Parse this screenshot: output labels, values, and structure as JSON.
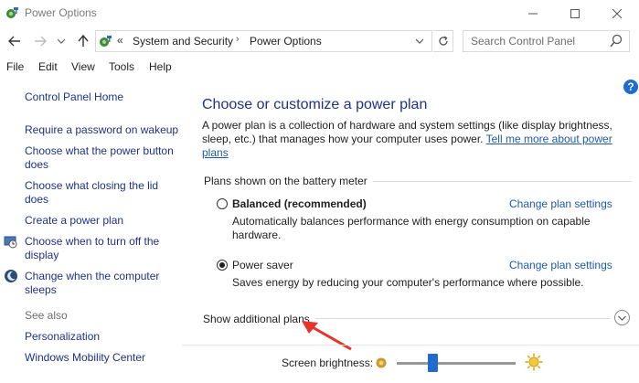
{
  "window": {
    "title": "Power Options"
  },
  "nav": {
    "breadcrumb_prefix": "«",
    "breadcrumbs": [
      "System and Security",
      "Power Options"
    ],
    "separator": "›",
    "search_placeholder": "Search Control Panel"
  },
  "menu": [
    "File",
    "Edit",
    "View",
    "Tools",
    "Help"
  ],
  "sidebar": {
    "home": "Control Panel Home",
    "tasks": [
      "Require a password on wakeup",
      "Choose what the power button does",
      "Choose what closing the lid does",
      "Create a power plan",
      "Choose when to turn off the display",
      "Change when the computer sleeps"
    ],
    "see_also_label": "See also",
    "see_also": [
      "Personalization",
      "Windows Mobility Center"
    ]
  },
  "main": {
    "title": "Choose or customize a power plan",
    "description": "A power plan is a collection of hardware and system settings (like display brightness, sleep, etc.) that manages how your computer uses power.",
    "description_link": "Tell me more about power plans",
    "section_header": "Plans shown on the battery meter",
    "plans": [
      {
        "name": "Balanced (recommended)",
        "description": "Automatically balances performance with energy consumption on capable hardware.",
        "selected": false,
        "link": "Change plan settings"
      },
      {
        "name": "Power saver",
        "description": "Saves energy by reducing your computer's performance where possible.",
        "selected": true,
        "link": "Change plan settings"
      }
    ],
    "show_additional": "Show additional plans",
    "help_symbol": "?"
  },
  "bottom": {
    "brightness_label": "Screen brightness:",
    "brightness_level": 0.3
  },
  "colors": {
    "link": "#1e3287",
    "accent": "#1f6bd0",
    "annotation_arrow": "#e8322b"
  },
  "icons": {
    "app": "power-options-icon",
    "back": "back-arrow-icon",
    "forward": "forward-arrow-icon",
    "up": "up-arrow-icon",
    "refresh": "refresh-icon",
    "search": "search-icon",
    "expand": "chevron-down-icon",
    "dim": "dim-brightness-icon",
    "bright": "bright-brightness-icon"
  }
}
